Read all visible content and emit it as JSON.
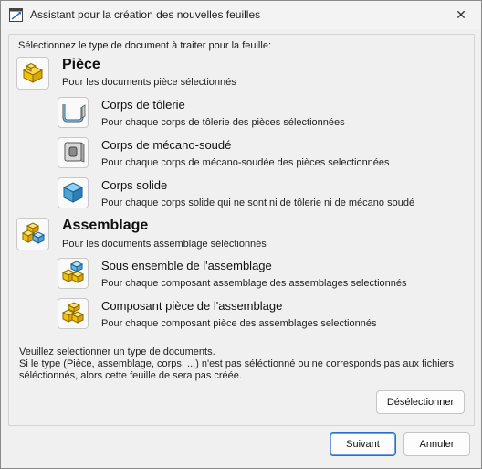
{
  "window": {
    "title": "Assistant pour la création des nouvelles feuilles",
    "close_glyph": "✕"
  },
  "prompt": "Sélectionnez le type de document à traiter pour la feuille:",
  "piece": {
    "heading": "Pièce",
    "description": "Pour les documents pièce sélectionnés",
    "icon": "part-icon",
    "items": [
      {
        "title": "Corps de tôlerie",
        "description": "Pour chaque corps de tôlerie des pièces sélectionnées",
        "icon": "sheet-metal-icon"
      },
      {
        "title": "Corps de mécano-soudé",
        "description": "Pour chaque corps de mécano-soudée des pièces selectionnées",
        "icon": "weldment-icon"
      },
      {
        "title": "Corps solide",
        "description": "Pour chaque corps solide qui ne sont ni de tôlerie ni de mécano soudé",
        "icon": "solid-body-icon"
      }
    ]
  },
  "assembly": {
    "heading": "Assemblage",
    "description": "Pour les documents assemblage séléctionnés",
    "icon": "assembly-icon",
    "items": [
      {
        "title": "Sous ensemble de l'assemblage",
        "description": "Pour chaque composant assemblage des assemblages selectionnés",
        "icon": "subassembly-icon"
      },
      {
        "title": "Composant pièce de l'assemblage",
        "description": "Pour chaque composant pièce des assemblages selectionnés",
        "icon": "component-part-icon"
      }
    ]
  },
  "note": {
    "line1": "Veuillez selectionner un type de documents.",
    "line2": "Si le type (Pièce, assemblage, corps, ...) n'est pas séléctionné ou ne corresponds pas aux fichiers",
    "line3": "séléctionnés, alors cette feuille de sera pas créée."
  },
  "buttons": {
    "deselect": "Désélectionner",
    "next": "Suivant",
    "cancel": "Annuler"
  },
  "colors": {
    "accent": "#2a6fc9",
    "part_yellow": "#f2c200",
    "solid_blue": "#4aa3d8"
  }
}
